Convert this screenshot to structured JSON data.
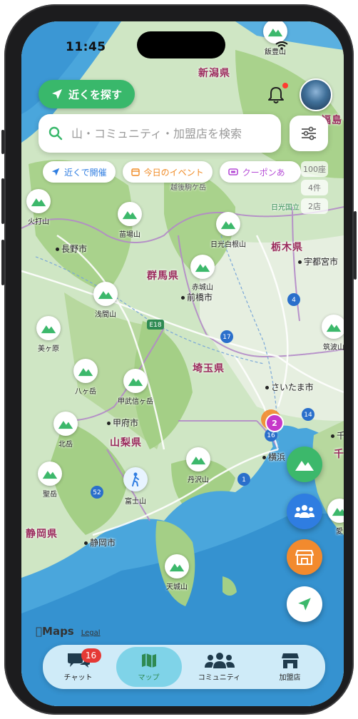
{
  "status": {
    "time": "11:45"
  },
  "header": {
    "near_button": "近くを探す",
    "search_placeholder": "山・コミュニティ・加盟店を検索"
  },
  "chips": [
    {
      "label": "近くで開催",
      "color": "#2f7de1"
    },
    {
      "label": "今日のイベント",
      "color": "#f08a24"
    },
    {
      "label": "クーポンあ",
      "color": "#b54bd6"
    }
  ],
  "counts": [
    "100座",
    "4件",
    "2店"
  ],
  "map": {
    "prefectures": [
      "新潟県",
      "群馬県",
      "栃木県",
      "埼玉県",
      "山梨県",
      "静岡県",
      "千",
      "福島"
    ],
    "cities": [
      "長野市",
      "前橋市",
      "宇都宮市",
      "さいたま市",
      "甲府市",
      "横浜",
      "静岡市",
      "千"
    ],
    "mountains": [
      "飯豊山",
      "火打山",
      "苗場山",
      "日光白根山",
      "赤城山",
      "浅間山",
      "美ヶ原",
      "八ヶ岳",
      "甲武信ヶ岳",
      "北岳",
      "丹沢山",
      "聖岳",
      "富士山",
      "天城山",
      "筑波山",
      "愛"
    ],
    "poi": [
      "日光国立",
      "越後駒ケ岳"
    ],
    "road_labels": [
      "E18",
      "17",
      "4",
      "14",
      "16",
      "1",
      "52"
    ],
    "cluster_count": "2",
    "attribution": {
      "logo": "Maps",
      "legal": "Legal"
    }
  },
  "colors": {
    "mountain_green": "#3cb86b",
    "community_blue": "#2f7de1",
    "shop_orange": "#f28a2e",
    "cluster_purple": "#c637c9"
  },
  "tabs": [
    {
      "label": "チャット",
      "badge": "16"
    },
    {
      "label": "マップ"
    },
    {
      "label": "コミュニティ"
    },
    {
      "label": "加盟店"
    }
  ]
}
